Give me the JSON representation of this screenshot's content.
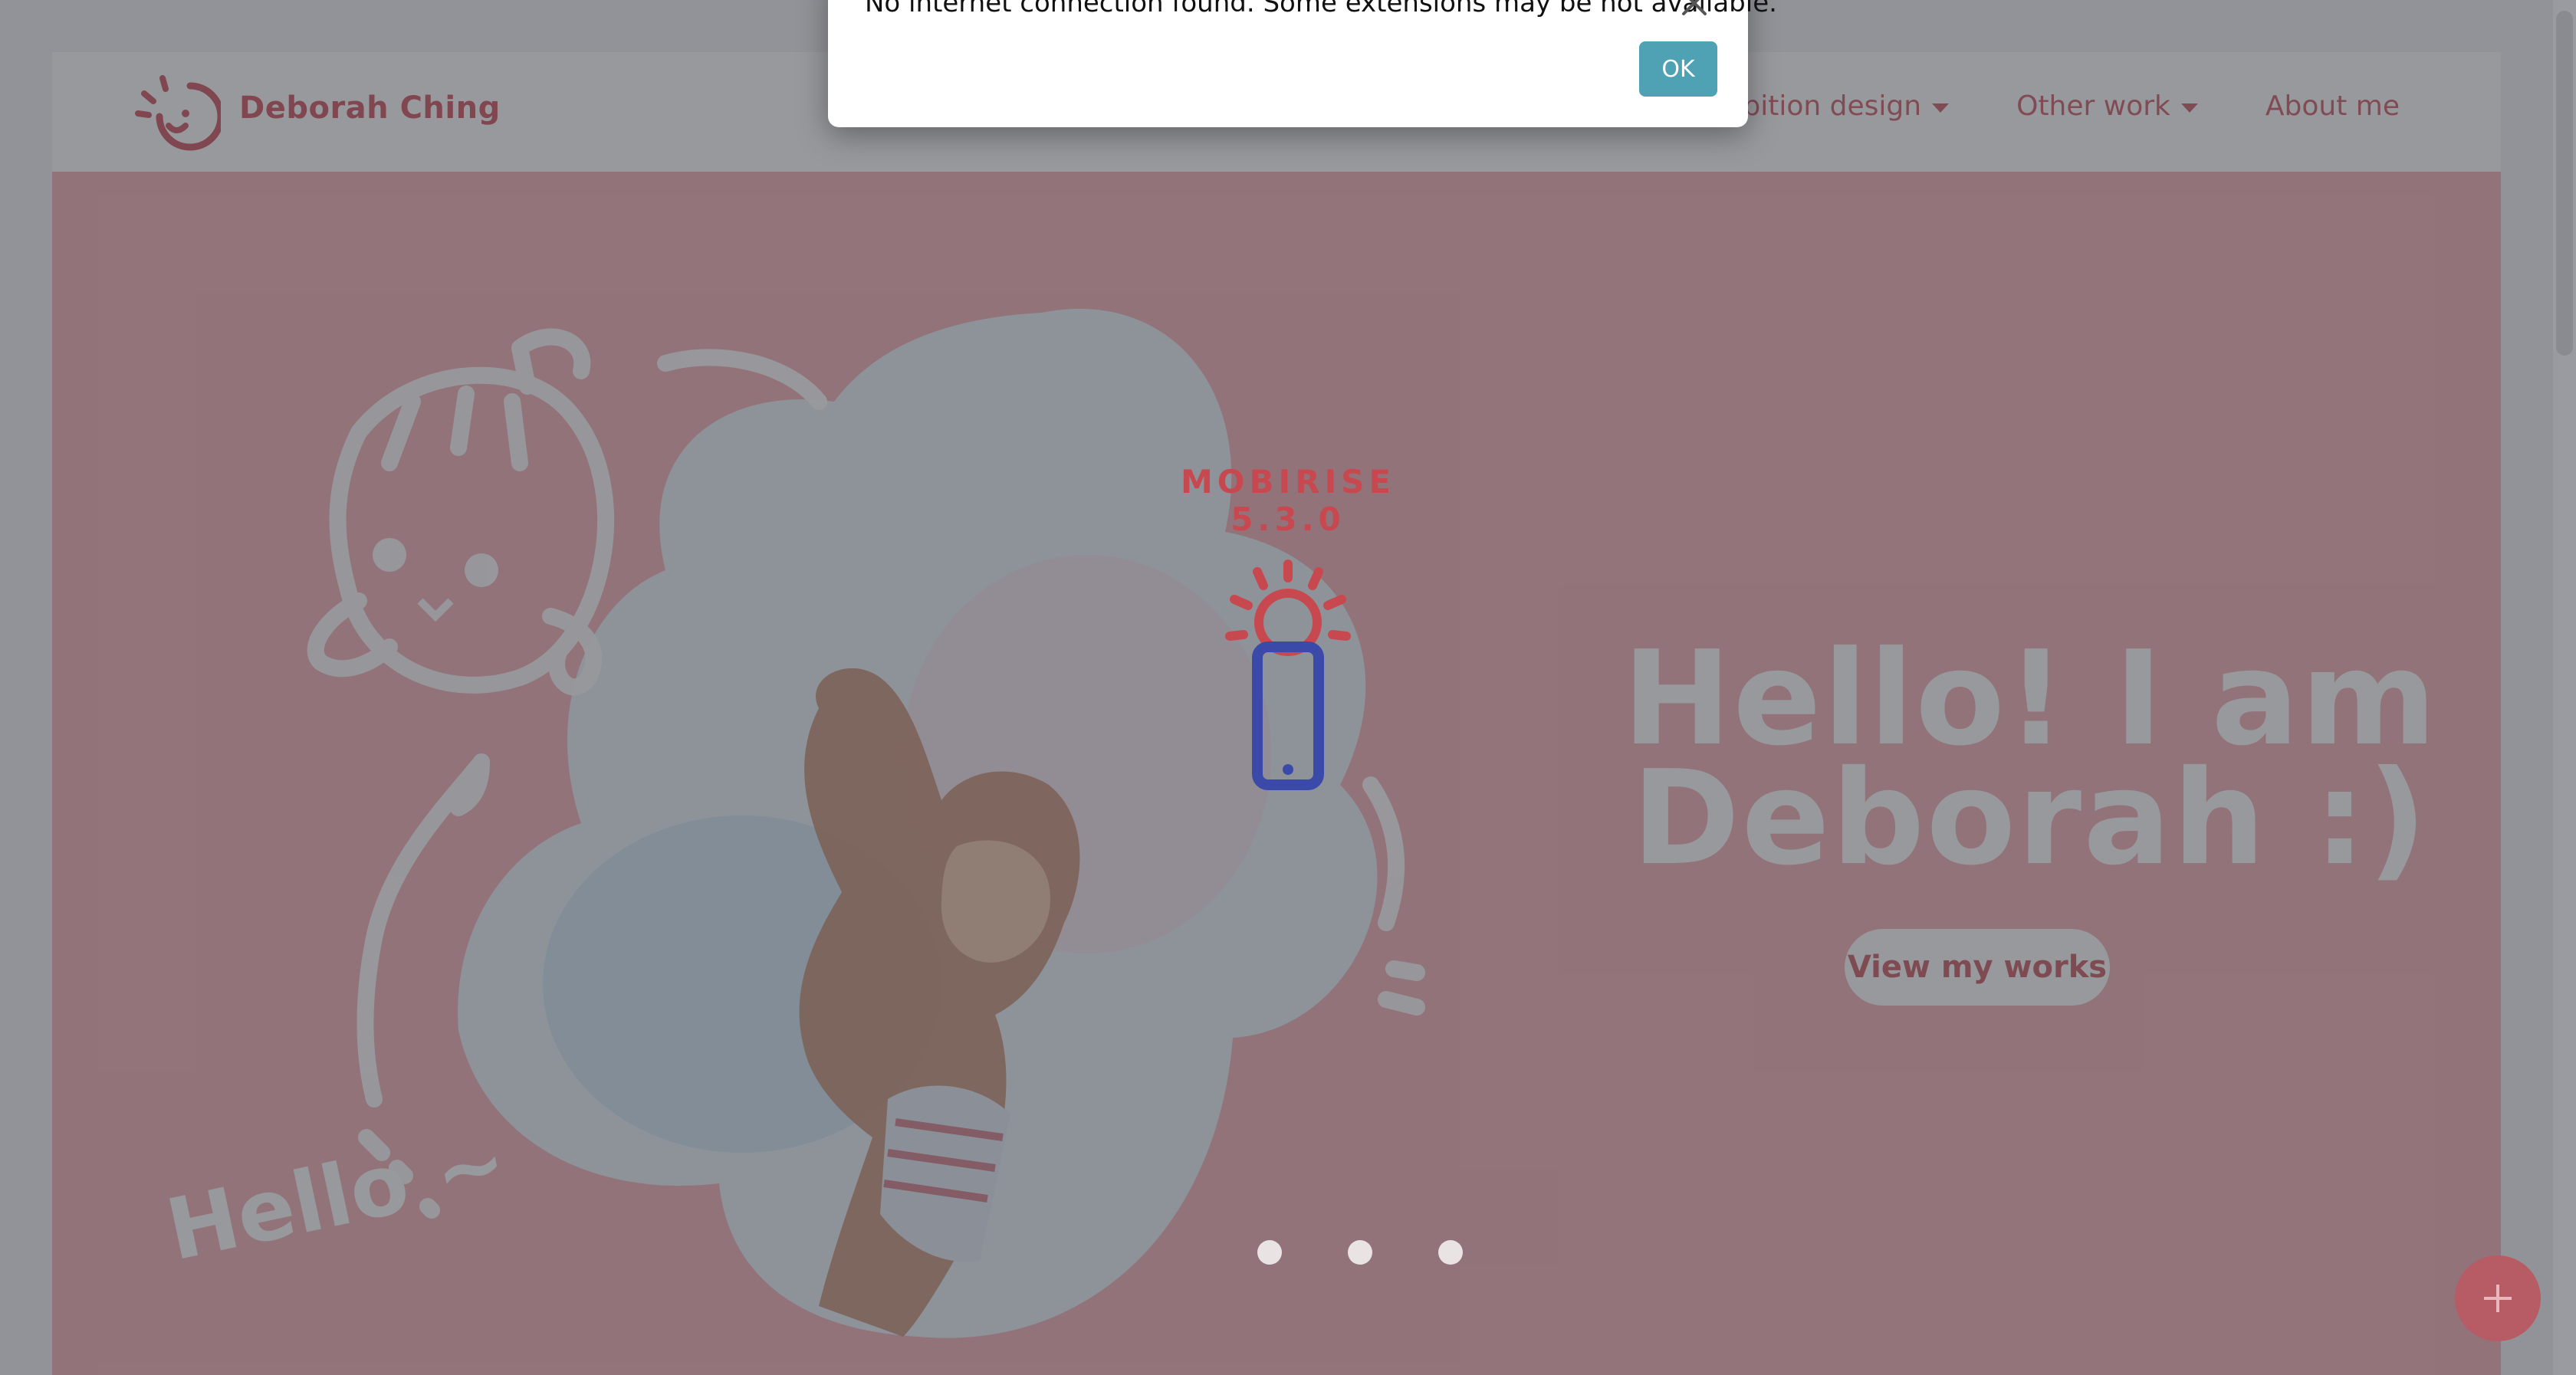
{
  "header": {
    "brand": "Deborah Ching",
    "nav": [
      {
        "label": "Exhibition design",
        "has_dropdown": true
      },
      {
        "label": "Other work",
        "has_dropdown": true
      },
      {
        "label": "About me",
        "has_dropdown": false
      }
    ]
  },
  "hero": {
    "headline_line1": "Hello! I am",
    "headline_line2": "Deborah :)",
    "cta_label": "View my works",
    "hello_doodle": "Hello ~"
  },
  "loader": {
    "brand": "MOBIRISE  5.3.0",
    "icon": "phone-sun-icon"
  },
  "dialog": {
    "message": "No internet connection found. Some extensions may be not available.",
    "ok_label": "OK",
    "close_icon": "close-icon"
  },
  "icons": {
    "logo": "smile-sun-logo-icon",
    "fab": "plus-icon"
  },
  "colors": {
    "brand_pink": "#d3626b",
    "hero_bg": "#f4b7bc",
    "dialog_button": "#4fa2b3",
    "loader_red": "#c7494f",
    "loader_blue": "#3b4aa8"
  }
}
